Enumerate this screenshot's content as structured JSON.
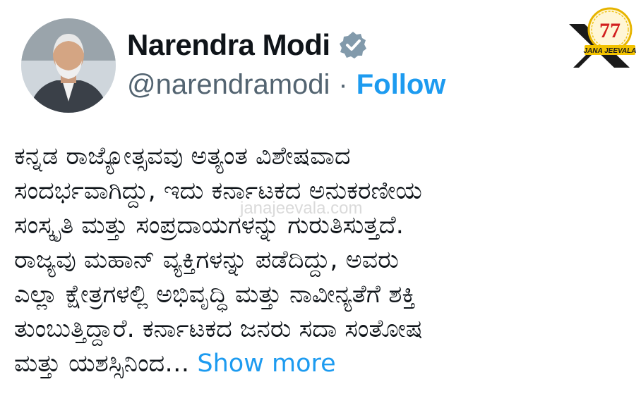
{
  "profile": {
    "name": "Narendra Modi",
    "handle": "@narendramodi",
    "separator": "·",
    "follow_label": "Follow"
  },
  "tweet": {
    "text": "ಕನ್ನಡ ರಾಜ್ಯೋತ್ಸವವು ಅತ್ಯಂತ ವಿಶೇಷವಾದ\nಸಂದರ್ಭವಾಗಿದ್ದು, ಇದು ಕರ್ನಾಟಕದ ಅನುಕರಣೀಯ\nಸಂಸ್ಕೃತಿ ಮತ್ತು ಸಂಪ್ರದಾಯಗಳನ್ನು ಗುರುತಿಸುತ್ತದೆ.\nರಾಜ್ಯವು ಮಹಾನ್ ವ್ಯಕ್ತಿಗಳನ್ನು ಪಡೆದಿದ್ದು, ಅವರು\nಎಲ್ಲಾ ಕ್ಷೇತ್ರಗಳಲ್ಲಿ ಅಭಿವೃದ್ಧಿ ಮತ್ತು ನಾವೀನ್ಯತೆಗೆ ಶಕ್ತಿ\nತುಂಬುತ್ತಿದ್ದಾರೆ. ಕರ್ನಾಟಕದ ಜನರು ಸದಾ ಸಂತೋಷ\nಮತ್ತು ಯಶಸ್ಸಿನಿಂದ…",
    "show_more_label": "Show more"
  },
  "watermark": "janajeevala.com",
  "logo": {
    "number": "77",
    "caption": "JANA JEEVALA",
    "icon": "x-logo-icon"
  },
  "colors": {
    "accent": "#1d9bf0",
    "secondary_text": "#536471",
    "primary_text": "#0f1419",
    "verified_badge": "#829aab"
  }
}
